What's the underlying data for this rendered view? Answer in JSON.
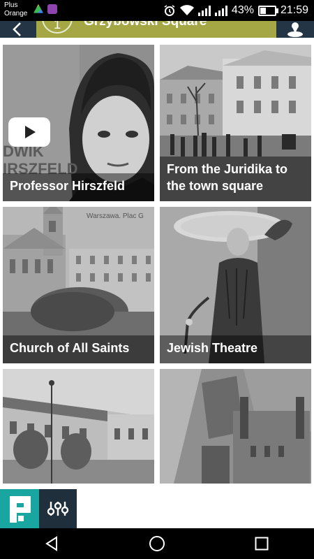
{
  "status_bar": {
    "carrier_line1": "Plus",
    "carrier_line2": "Orange",
    "battery_percent": "43%",
    "battery_level": 0.43,
    "time": "21:59"
  },
  "header": {
    "stop_number": "1",
    "title": "Grzybowski Square"
  },
  "tiles": [
    {
      "label": "Professor Hirszfeld",
      "photo_text": "DWIK IRSZFELD",
      "has_video": true
    },
    {
      "label": "From the Juridika to the town square",
      "has_video": false
    },
    {
      "label": "Church of All Saints",
      "photo_text": "Warszawa.   Plac G",
      "has_video": false
    },
    {
      "label": "Jewish Theatre",
      "has_video": false
    },
    {
      "label": "",
      "has_video": false
    },
    {
      "label": "",
      "has_video": false
    }
  ],
  "colors": {
    "header_dark": "#243545",
    "header_accent": "#a4a744",
    "logo_teal": "#1aa6a0",
    "filter_dark": "#1f2f3c"
  },
  "icons": {
    "back": "arrow-left-icon",
    "map": "map-pin-icon",
    "logo": "app-logo-icon",
    "filter": "sliders-icon",
    "nav_back": "triangle-back-icon",
    "nav_home": "circle-home-icon",
    "nav_recent": "square-recent-icon"
  }
}
